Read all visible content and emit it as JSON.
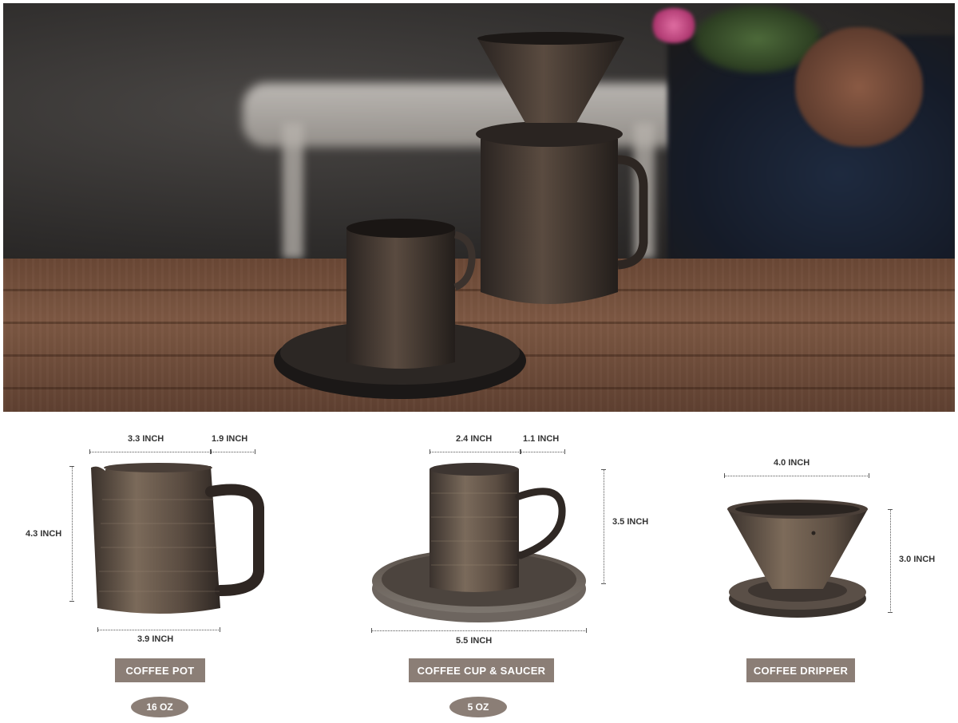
{
  "products": [
    {
      "name": "COFFEE POT",
      "capacity": "16 OZ",
      "dimensions": {
        "top_left": "3.3 INCH",
        "top_right": "1.9 INCH",
        "height": "4.3 INCH",
        "bottom": "3.9 INCH"
      }
    },
    {
      "name": "COFFEE CUP & SAUCER",
      "capacity": "5 OZ",
      "dimensions": {
        "top_left": "2.4 INCH",
        "top_right": "1.1 INCH",
        "height": "3.5 INCH",
        "bottom": "5.5 INCH"
      }
    },
    {
      "name": "COFFEE DRIPPER",
      "dimensions": {
        "top": "4.0 INCH",
        "height": "3.0 INCH"
      }
    }
  ],
  "colors": {
    "label_bg": "#8b7e76",
    "label_text": "#ffffff",
    "ceramic_dark": "#3a322d",
    "ceramic_bronze": "#6e5f52"
  }
}
